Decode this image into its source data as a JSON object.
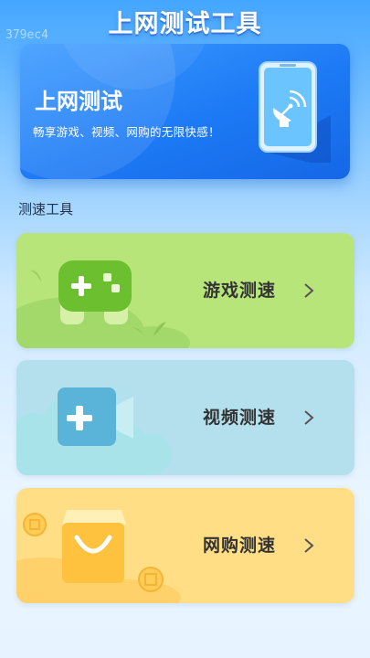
{
  "header": {
    "title": "上网测试工具",
    "watermark": "379ec4"
  },
  "hero": {
    "title": "上网测试",
    "subtitle": "畅享游戏、视频、网购的无限快感！",
    "icon": "phone-wifi-icon"
  },
  "section": {
    "title": "测速工具"
  },
  "tools": [
    {
      "label": "游戏测速",
      "icon": "gamepad-icon",
      "color": "#b8e57a"
    },
    {
      "label": "视频测速",
      "icon": "video-camera-icon",
      "color": "#b4e0ee"
    },
    {
      "label": "网购测速",
      "icon": "shopping-bag-icon",
      "color": "#ffde86"
    }
  ]
}
